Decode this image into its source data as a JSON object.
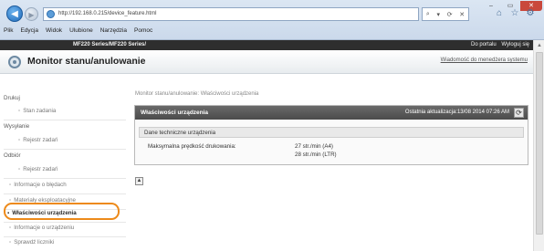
{
  "browser": {
    "url": "http://192.168.0.215/device_feature.html",
    "addr_tools": [
      "⌕",
      "▾",
      "⟳",
      "✕"
    ],
    "window_controls": [
      "–",
      "▭",
      "✕"
    ],
    "menu": [
      "Plik",
      "Edycja",
      "Widok",
      "Ulubione",
      "Narzędzia",
      "Pomoc"
    ]
  },
  "banner": {
    "model": "MF220 Series/MF220 Series/",
    "link_portal": "Do portalu",
    "link_logout": "Wyloguj się"
  },
  "subheader": {
    "title": "Monitor stanu/anulowanie",
    "manager_link": "Wiadomość do menedżera systemu"
  },
  "sidebar": {
    "drukuj": "Drukuj",
    "stan_zadania": "Stan zadania",
    "wysylanie": "Wysyłanie",
    "rejestr_zadan_1": "Rejestr zadań",
    "odbior": "Odbiór",
    "rejestr_zadan_2": "Rejestr zadań",
    "informacje_o_bledach": "Informacje o błędach",
    "materialy": "Materiały eksploatacyjne",
    "wlasciwosci": "Właściwości urządzenia",
    "informacje_o_urzadzeniu": "Informacje o urządzeniu",
    "sprawdz_liczniki": "Sprawdź liczniki"
  },
  "main": {
    "breadcrumb": "Monitor stanu/anulowanie: Właściwości urządzenia",
    "panel_title": "Właściwości urządzenia",
    "last_update": "Ostatnia aktualizacja:13/08 2014 07:26 AM",
    "section_title": "Dane techniczne urządzenia",
    "property_label": "Maksymalna prędkość drukowania:",
    "property_values": [
      "27 str./min (A4)",
      "28 str./min (LTR)"
    ]
  },
  "colors": {
    "highlight": "#ed8a1a",
    "panel_header": "#555555",
    "banner": "#2e2e2e"
  },
  "icons": [
    "back-arrow-icon",
    "forward-arrow-icon",
    "site-icon",
    "home-icon",
    "star-icon",
    "gear-icon",
    "monitor-icon",
    "refresh-icon",
    "top-of-page-icon"
  ]
}
